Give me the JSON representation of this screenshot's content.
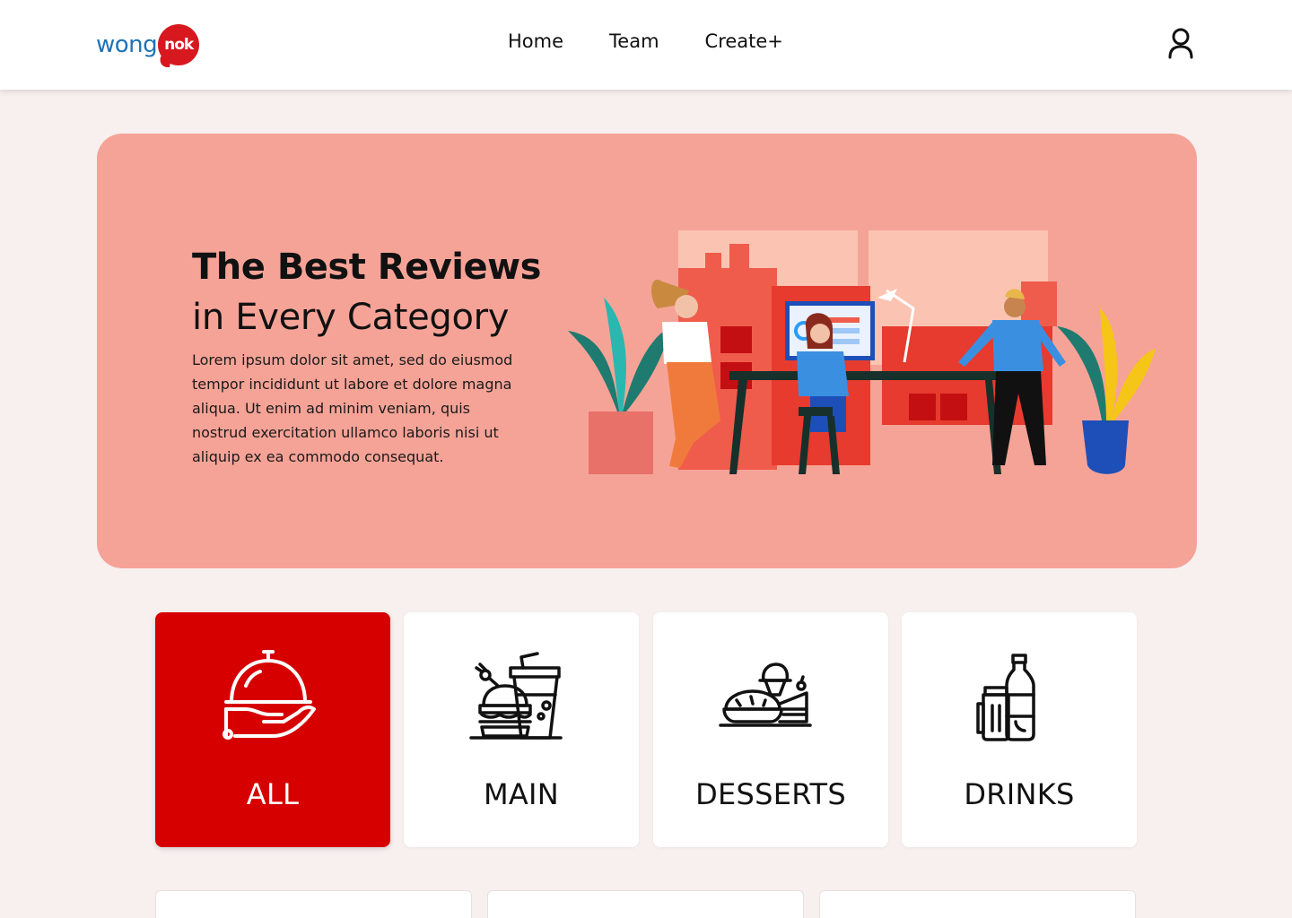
{
  "header": {
    "logo": {
      "word": "wong",
      "bubble": "nok"
    },
    "nav": [
      {
        "label": "Home"
      },
      {
        "label": "Team"
      },
      {
        "label": "Create+"
      }
    ],
    "user_icon": "user-icon"
  },
  "hero": {
    "title": "The Best Reviews",
    "subtitle": "in Every Category",
    "body": "Lorem ipsum dolor sit amet, sed do eiusmod tempor incididunt ut labore et dolore magna aliqua. Ut enim ad minim veniam, quis nostrud exercitation ullamco laboris nisi ut aliquip ex ea commodo consequat.",
    "illustration": "office-team-illustration"
  },
  "categories": [
    {
      "label": "ALL",
      "icon": "cloche-serving-icon",
      "active": true
    },
    {
      "label": "MAIN",
      "icon": "burger-drink-icon",
      "active": false
    },
    {
      "label": "DESSERTS",
      "icon": "desserts-icon",
      "active": false
    },
    {
      "label": "DRINKS",
      "icon": "bottles-icon",
      "active": false
    }
  ],
  "colors": {
    "background": "#F7F0EF",
    "hero": "#F6A397",
    "accent_red": "#D60000",
    "logo_blue": "#1E73B8",
    "logo_red": "#D7181F"
  }
}
